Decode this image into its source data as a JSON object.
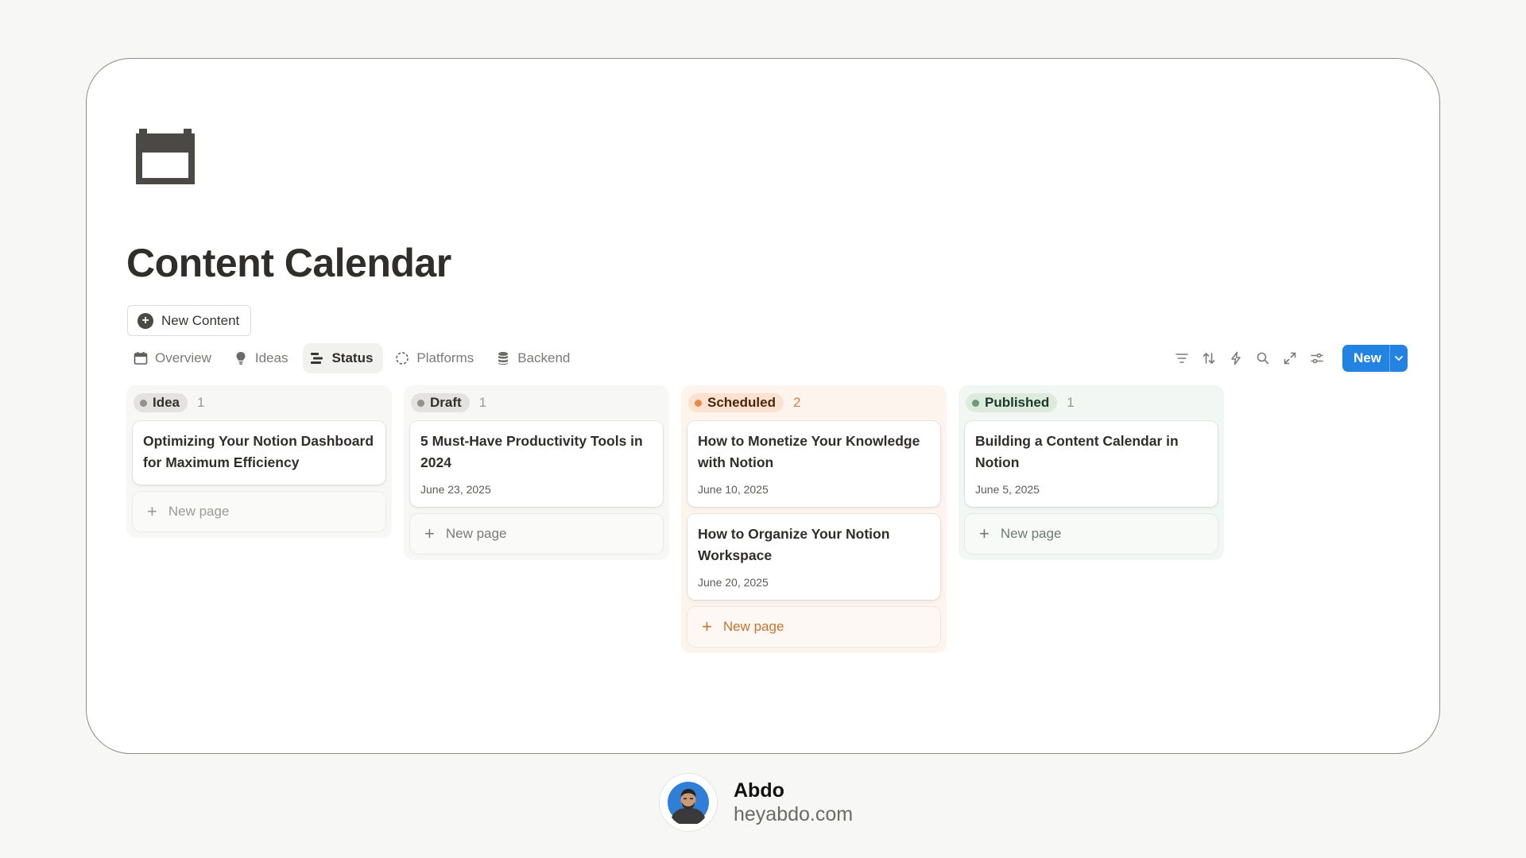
{
  "page": {
    "title": "Content Calendar",
    "icon": "calendar-icon",
    "new_content_label": "New Content"
  },
  "tabs": [
    {
      "label": "Overview",
      "icon": "calendar-icon",
      "active": false
    },
    {
      "label": "Ideas",
      "icon": "lightbulb-icon",
      "active": false
    },
    {
      "label": "Status",
      "icon": "board-icon",
      "active": true
    },
    {
      "label": "Platforms",
      "icon": "dashed-circle-icon",
      "active": false
    },
    {
      "label": "Backend",
      "icon": "database-icon",
      "active": false
    }
  ],
  "toolbar": {
    "icons": [
      "filter-icon",
      "sort-icon",
      "lightning-icon",
      "search-icon",
      "expand-icon",
      "settings-sliders-icon"
    ],
    "new_label": "New"
  },
  "columns": [
    {
      "name": "Idea",
      "count": "1",
      "colors": {
        "bg": "#f7f7f5",
        "pill": "#e3e2e0",
        "dot": "#91918e",
        "text": "#32302c",
        "count": "#9b9a97",
        "new_page": "#9b9a97"
      },
      "cards": [
        {
          "title": "Optimizing Your Notion Dashboard for Maximum Efficiency",
          "date": ""
        }
      ],
      "new_page_label": "New page"
    },
    {
      "name": "Draft",
      "count": "1",
      "colors": {
        "bg": "#f7f7f5",
        "pill": "#e3e2e0",
        "dot": "#91918e",
        "text": "#32302c",
        "count": "#9b9a97",
        "new_page": "#7b7a76"
      },
      "cards": [
        {
          "title": "5 Must-Have Productivity Tools in 2024",
          "date": "June 23, 2025"
        }
      ],
      "new_page_label": "New page"
    },
    {
      "name": "Scheduled",
      "count": "2",
      "colors": {
        "bg": "#fdf4ee",
        "pill": "#fbe1cf",
        "dot": "#e58a4b",
        "text": "#49290e",
        "count": "#d9803c",
        "new_page": "#c7742f"
      },
      "cards": [
        {
          "title": "How to Monetize Your Knowledge with Notion",
          "date": "June 10, 2025"
        },
        {
          "title": "How to Organize Your Notion Workspace",
          "date": "June 20, 2025"
        }
      ],
      "new_page_label": "New page"
    },
    {
      "name": "Published",
      "count": "1",
      "colors": {
        "bg": "#f3f7f3",
        "pill": "#dcebdc",
        "dot": "#6c9b7d",
        "text": "#1c3829",
        "count": "#8a9b8f",
        "new_page": "#6f7a72"
      },
      "cards": [
        {
          "title": "Building a Content Calendar in Notion",
          "date": "June 5, 2025"
        }
      ],
      "new_page_label": "New page"
    }
  ],
  "author": {
    "name": "Abdo",
    "site": "heyabdo.com"
  }
}
